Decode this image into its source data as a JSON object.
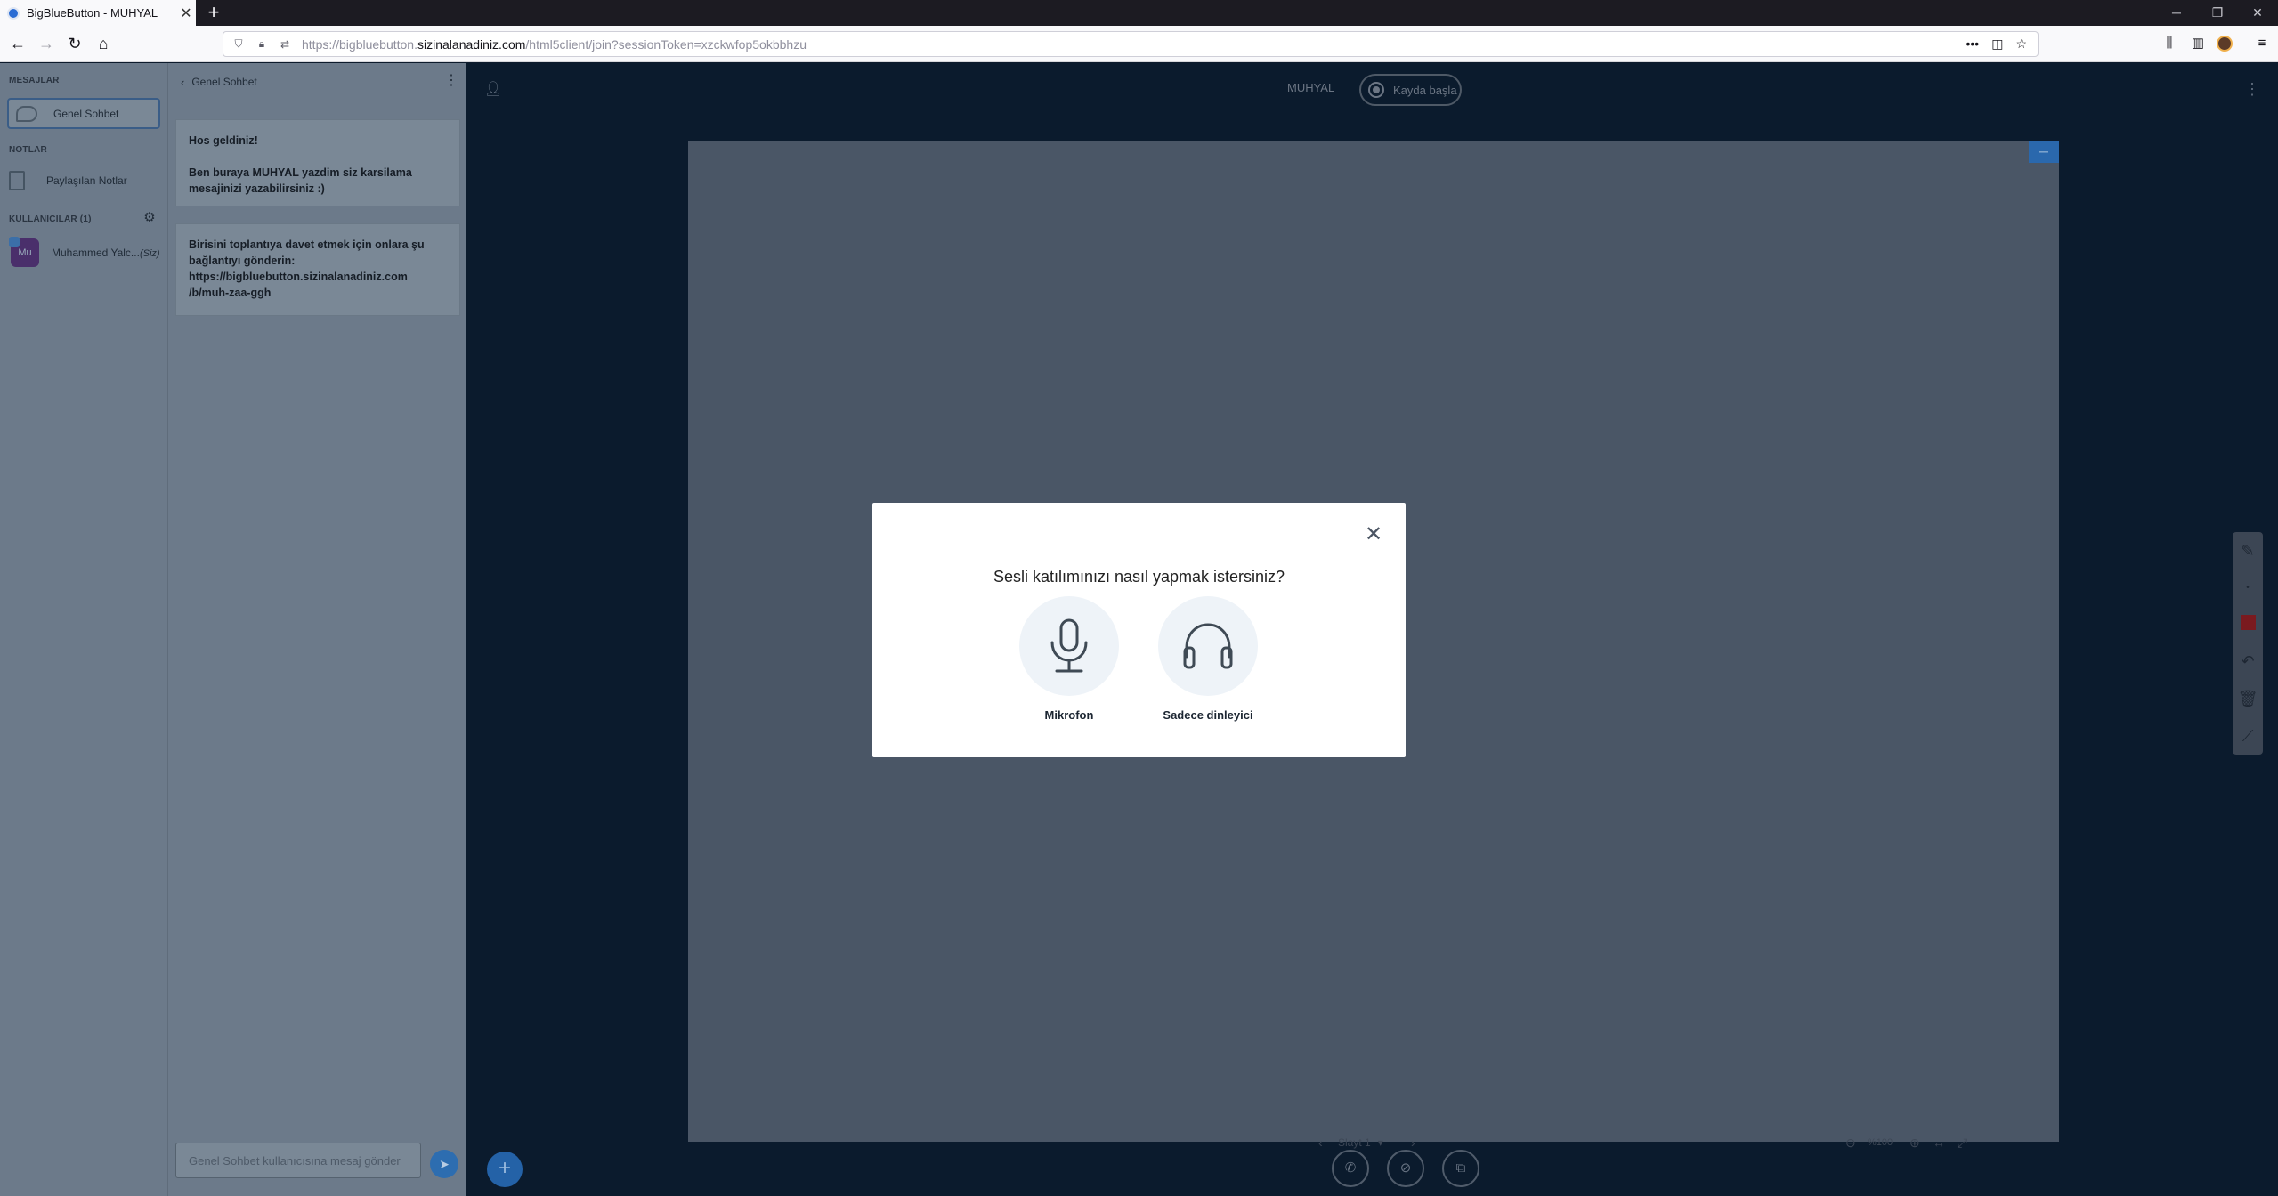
{
  "browser": {
    "tab_title": "BigBlueButton - MUHYAL",
    "tab_close": "✕",
    "new_tab": "+",
    "url_prefix": "https://bigbluebutton.",
    "url_domain": "sizinalanadiniz.com",
    "url_path": "/html5client/join?sessionToken=xzckwfop5okbbhzu"
  },
  "sidebar": {
    "messages_label": "MESAJLAR",
    "general_chat": "Genel Sohbet",
    "notes_label": "NOTLAR",
    "shared_notes": "Paylaşılan Notlar",
    "users_label": "KULLANICILAR (1)",
    "user_name": "Muhammed Yalc...",
    "user_you": "(Siz)",
    "user_initials": "Mu"
  },
  "chat": {
    "header": "Genel Sohbet",
    "welcome_line1": "Hos geldiniz!",
    "welcome_line2": "Ben buraya MUHYAL yazdim siz karsilama mesajinizi yazabilirsiniz :)",
    "invite_line1": "Birisini toplantıya davet etmek için onlara şu bağlantıyı gönderin:",
    "invite_line2": "https://bigbluebutton.sizinalanadiniz.com",
    "invite_line3": "/b/muh-zaa-ggh",
    "input_placeholder": "Genel Sohbet kullanıcısına mesaj gönder"
  },
  "main": {
    "meeting_name": "MUHYAL",
    "record_label": "Kayda başla",
    "slide_label": "Slayt 1",
    "zoom_label": "%100"
  },
  "modal": {
    "title": "Sesli katılımınızı nasıl yapmak istersiniz?",
    "mic_label": "Mikrofon",
    "listen_label": "Sadece dinleyici"
  },
  "colors": {
    "accent": "#2462a7",
    "annotation_color": "#7a1a1f"
  }
}
